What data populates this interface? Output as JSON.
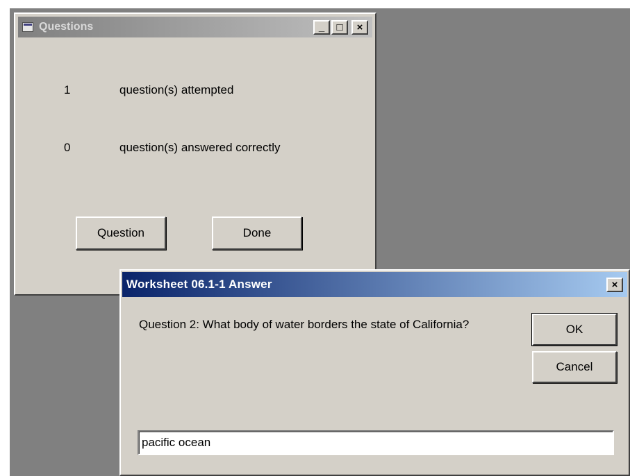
{
  "questions_window": {
    "title": "Questions",
    "title_buttons": {
      "minimize": "_",
      "maximize": "□",
      "close": "×"
    },
    "stats": [
      {
        "count": "1",
        "label": "question(s) attempted"
      },
      {
        "count": "0",
        "label": "question(s) answered correctly"
      }
    ],
    "buttons": {
      "question": "Question",
      "done": "Done"
    }
  },
  "answer_dialog": {
    "title": "Worksheet 06.1-1 Answer",
    "close_label": "×",
    "prompt": "Question 2: What body of water borders the state of California?",
    "ok_label": "OK",
    "cancel_label": "Cancel",
    "answer_value": "pacific ocean"
  }
}
